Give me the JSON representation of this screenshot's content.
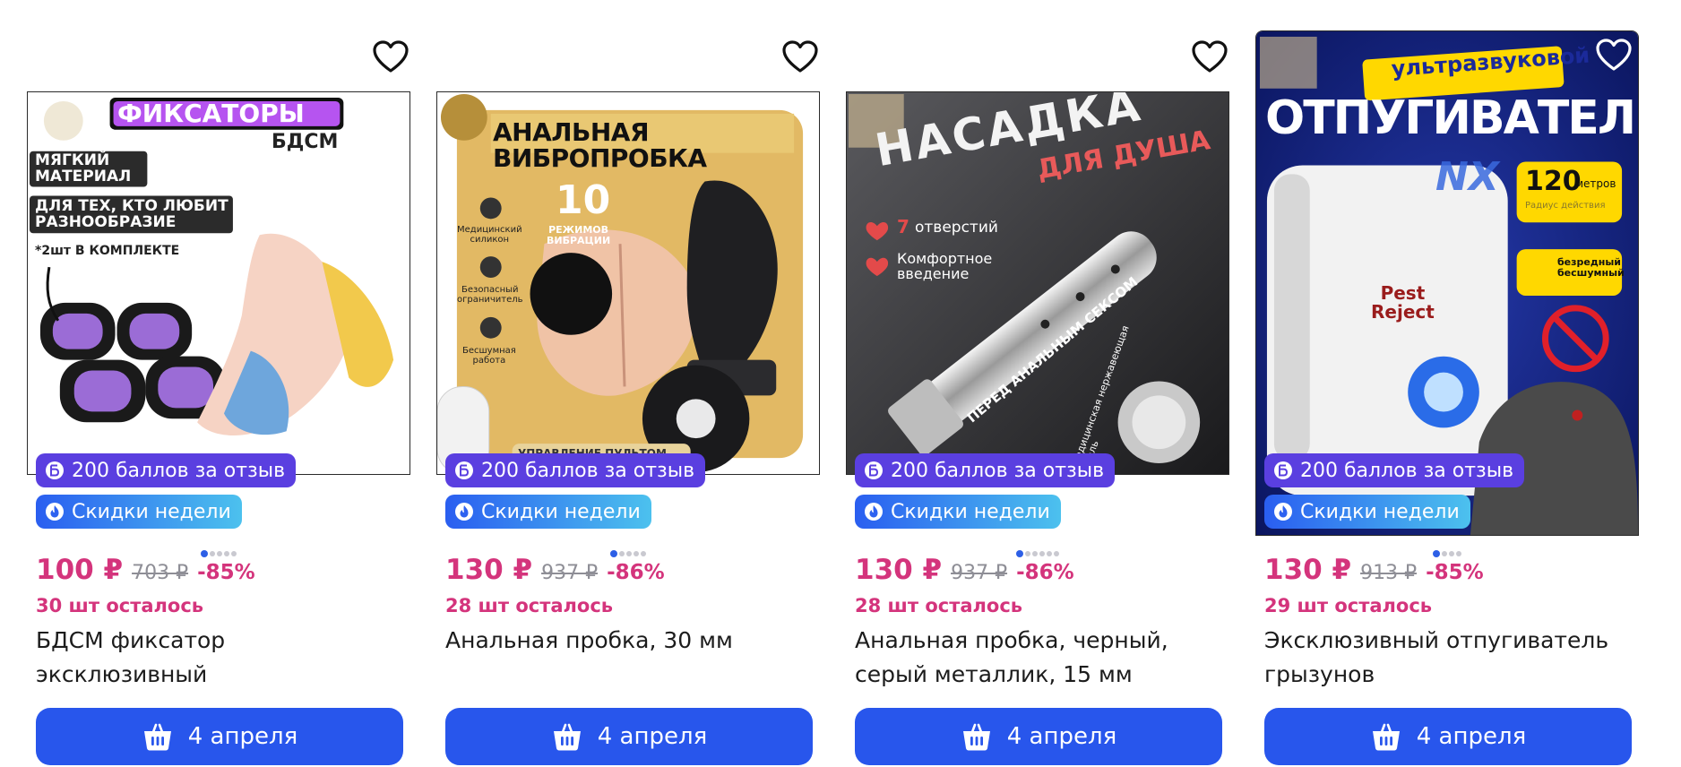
{
  "products": [
    {
      "image_text": [
        "ФИКСАТОРЫ",
        "БДСМ",
        "МЯГКИЙ\nМАТЕРИАЛ",
        "ДЛЯ ТЕХ, КТО ЛЮБИТ\nРАЗНООБРАЗИЕ",
        "*2шт В КОМПЛЕКТЕ"
      ],
      "badge_points": "200 баллов за отзыв",
      "badge_sale": "Скидки недели",
      "price": "100 ₽",
      "old_price": "703 ₽",
      "discount": "-85%",
      "stock": "30 шт осталось",
      "title": "БДСМ фиксатор эксклюзивный",
      "buy_label": "4 апреля",
      "image_count": 5,
      "active_image": 1
    },
    {
      "image_text": [
        "АНАЛЬНАЯ ВИБРОПРОБКА",
        "10",
        "РЕЖИМОВ\nВИБРАЦИИ",
        "Медицинский\nсиликон",
        "Безопасный\nограничитель",
        "Бесшумная\nработа",
        "УПРАВЛЕНИЕ ПУЛЬТОМ"
      ],
      "badge_points": "200 баллов за отзыв",
      "badge_sale": "Скидки недели",
      "price": "130 ₽",
      "old_price": "937 ₽",
      "discount": "-86%",
      "stock": "28 шт осталось",
      "title": "Анальная пробка, 30 мм",
      "buy_label": "4 апреля",
      "image_count": 5,
      "active_image": 1
    },
    {
      "image_text": [
        "НАСАДКА",
        "ДЛЯ ДУША",
        "7",
        "отверстий",
        "Комфортное\nвведение",
        "ПЕРЕД АНАЛЬНЫМ СЕКСОМ",
        "медицинская нержавеющая сталь"
      ],
      "badge_points": "200 баллов за отзыв",
      "badge_sale": "Скидки недели",
      "price": "130 ₽",
      "old_price": "937 ₽",
      "discount": "-86%",
      "stock": "28 шт осталось",
      "title": "Анальная пробка, черный, серый металлик, 15 мм",
      "buy_label": "4 апреля",
      "image_count": 6,
      "active_image": 1
    },
    {
      "image_text": [
        "ультразвуковой",
        "ОТПУГИВАТЕЛЬ",
        "120",
        "метров",
        "Радиус действия",
        "безредный\nбесшумный",
        "Pest\nReject",
        "NX"
      ],
      "badge_points": "200 баллов за отзыв",
      "badge_sale": "Скидки недели",
      "price": "130 ₽",
      "old_price": "913 ₽",
      "discount": "-85%",
      "stock": "29 шт осталось",
      "title": "Эксклюзивный отпугиватель грызунов",
      "buy_label": "4 апреля",
      "image_count": 4,
      "active_image": 1
    }
  ],
  "colors": {
    "price": "#d4347c",
    "old_price": "#8e8e96",
    "points_badge": "#5a3fe0",
    "buy_button": "#2856ec",
    "dot_active": "#2d5fe6",
    "dot_inactive": "#c9c9d0"
  },
  "icons": {
    "favorite": "heart-outline-icon",
    "points": "b-points-icon",
    "sale": "flame-icon",
    "buy": "basket-icon"
  }
}
